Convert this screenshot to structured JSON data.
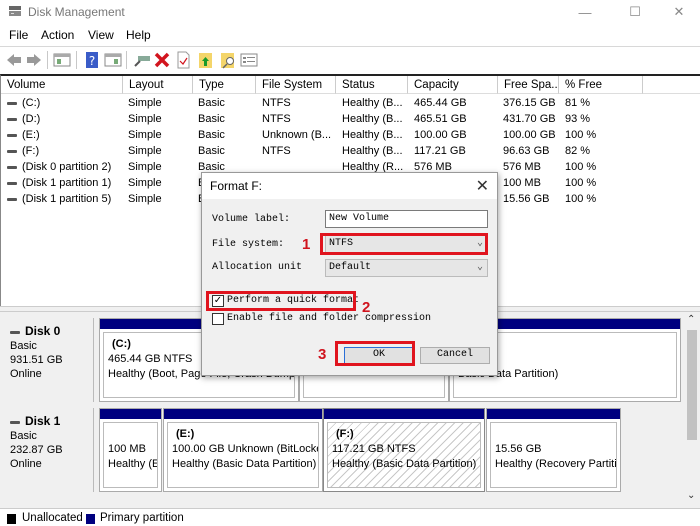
{
  "window": {
    "title": "Disk Management",
    "controls": {
      "minimize": "—",
      "maximize": "☐",
      "close": "✕"
    }
  },
  "menu": [
    "File",
    "Action",
    "View",
    "Help"
  ],
  "toolbar": {
    "icons": [
      "back-icon",
      "forward-icon",
      "show-hide-console-tree-icon",
      "help-icon",
      "show-hide-action-pane-icon",
      "connect-drive-icon",
      "delete-icon",
      "properties-icon",
      "export-list-icon",
      "find-icon",
      "details-icon"
    ]
  },
  "volume_list": {
    "columns": [
      "Volume",
      "Layout",
      "Type",
      "File System",
      "Status",
      "Capacity",
      "Free Spa...",
      "% Free"
    ],
    "rows": [
      [
        "(C:)",
        "Simple",
        "Basic",
        "NTFS",
        "Healthy (B...",
        "465.44 GB",
        "376.15 GB",
        "81 %"
      ],
      [
        "(D:)",
        "Simple",
        "Basic",
        "NTFS",
        "Healthy (B...",
        "465.51 GB",
        "431.70 GB",
        "93 %"
      ],
      [
        "(E:)",
        "Simple",
        "Basic",
        "Unknown (B...",
        "Healthy (B...",
        "100.00 GB",
        "100.00 GB",
        "100 %"
      ],
      [
        "(F:)",
        "Simple",
        "Basic",
        "NTFS",
        "Healthy (B...",
        "117.21 GB",
        "96.63 GB",
        "82 %"
      ],
      [
        "(Disk 0 partition 2)",
        "Simple",
        "Basic",
        "",
        "Healthy (R...",
        "576 MB",
        "576 MB",
        "100 %"
      ],
      [
        "(Disk 1 partition 1)",
        "Simple",
        "B",
        "",
        "",
        "",
        "100 MB",
        "100 %"
      ],
      [
        "(Disk 1 partition 5)",
        "Simple",
        "B",
        "",
        "",
        "",
        "15.56 GB",
        "100 %"
      ]
    ]
  },
  "disks": [
    {
      "name": "Disk 0",
      "type": "Basic",
      "size": "931.51 GB",
      "state": "Online",
      "partitions": [
        {
          "label": "(C:)",
          "line1": "465.44 GB NTFS",
          "line2": "Healthy (Boot, Page File, Crash Dump, Basic Data Partition)"
        },
        {
          "label": "",
          "line1": "",
          "line2": ""
        },
        {
          "label": "",
          "line1": "3 NTFS",
          "line2": "Basic Data Partition)"
        }
      ]
    },
    {
      "name": "Disk 1",
      "type": "Basic",
      "size": "232.87 GB",
      "state": "Online",
      "partitions": [
        {
          "label": "",
          "line1": "100 MB",
          "line2": "Healthy (E"
        },
        {
          "label": "(E:)",
          "line1": "100.00 GB Unknown (BitLocke",
          "line2": "Healthy (Basic Data Partition)"
        },
        {
          "label": "(F:)",
          "line1": "117.21 GB NTFS",
          "line2": "Healthy (Basic Data Partition)",
          "selected": true
        },
        {
          "label": "",
          "line1": "15.56 GB",
          "line2": "Healthy (Recovery Partiti"
        }
      ]
    }
  ],
  "legend": [
    {
      "label": "Unallocated",
      "color": "#000000"
    },
    {
      "label": "Primary partition",
      "color": "#00007f"
    }
  ],
  "dialog": {
    "title": "Format F:",
    "volume_label_label": "Volume label:",
    "volume_label_value": "New Volume",
    "file_system_label": "File system:",
    "file_system_value": "NTFS",
    "allocation_unit_label": "Allocation unit",
    "allocation_unit_value": "Default",
    "quick_format_label": "Perform a quick format",
    "quick_format_checked": true,
    "compression_label": "Enable file and folder compression",
    "compression_checked": false,
    "ok_label": "OK",
    "cancel_label": "Cancel"
  },
  "annotations": {
    "step1": "1",
    "step2": "2",
    "step3": "3",
    "highlight_color": "#e0141e"
  }
}
